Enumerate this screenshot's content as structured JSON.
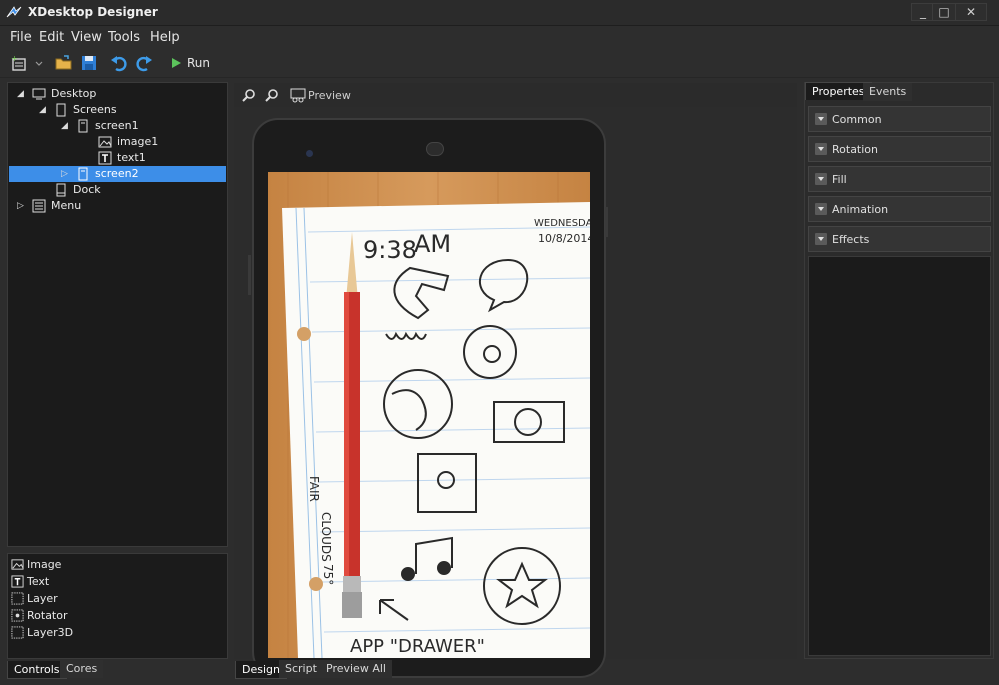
{
  "app": {
    "title": "XDesktop Designer"
  },
  "window_controls": {
    "minimize": "_",
    "maximize": "□",
    "close": "✕"
  },
  "menu": [
    "File",
    "Edit",
    "View",
    "Tools",
    "Help"
  ],
  "toolbar": {
    "run_label": "Run"
  },
  "tree": {
    "items": [
      {
        "label": "Desktop"
      },
      {
        "label": "Screens"
      },
      {
        "label": "screen1"
      },
      {
        "label": "image1"
      },
      {
        "label": "text1"
      },
      {
        "label": "screen2"
      },
      {
        "label": "Dock"
      },
      {
        "label": "Menu"
      }
    ]
  },
  "controls": {
    "items": [
      {
        "label": "Image"
      },
      {
        "label": "Text"
      },
      {
        "label": "Layer"
      },
      {
        "label": "Rotator"
      },
      {
        "label": "Layer3D"
      }
    ],
    "tabs": [
      "Controls",
      "Cores"
    ]
  },
  "center": {
    "preview_label": "Preview",
    "bottom_tabs": [
      "Design",
      "Script",
      "Preview All"
    ]
  },
  "phone_content": {
    "time": "9:38",
    "ampm": "AM",
    "day": "WEDNESDAY",
    "date": "10/8/2014",
    "weather_a": "FAIR",
    "weather_b": "CLOUDS",
    "temp": "75°",
    "drawer": "APP \"DRAWER\""
  },
  "properties": {
    "tabs": [
      "Propertes",
      "Events"
    ],
    "sections": [
      "Common",
      "Rotation",
      "Fill",
      "Animation",
      "Effects"
    ]
  },
  "colors": {
    "selection": "#3d8ee8",
    "panel_bg": "#1b1b1b",
    "chrome_bg": "#2d2d2d"
  }
}
